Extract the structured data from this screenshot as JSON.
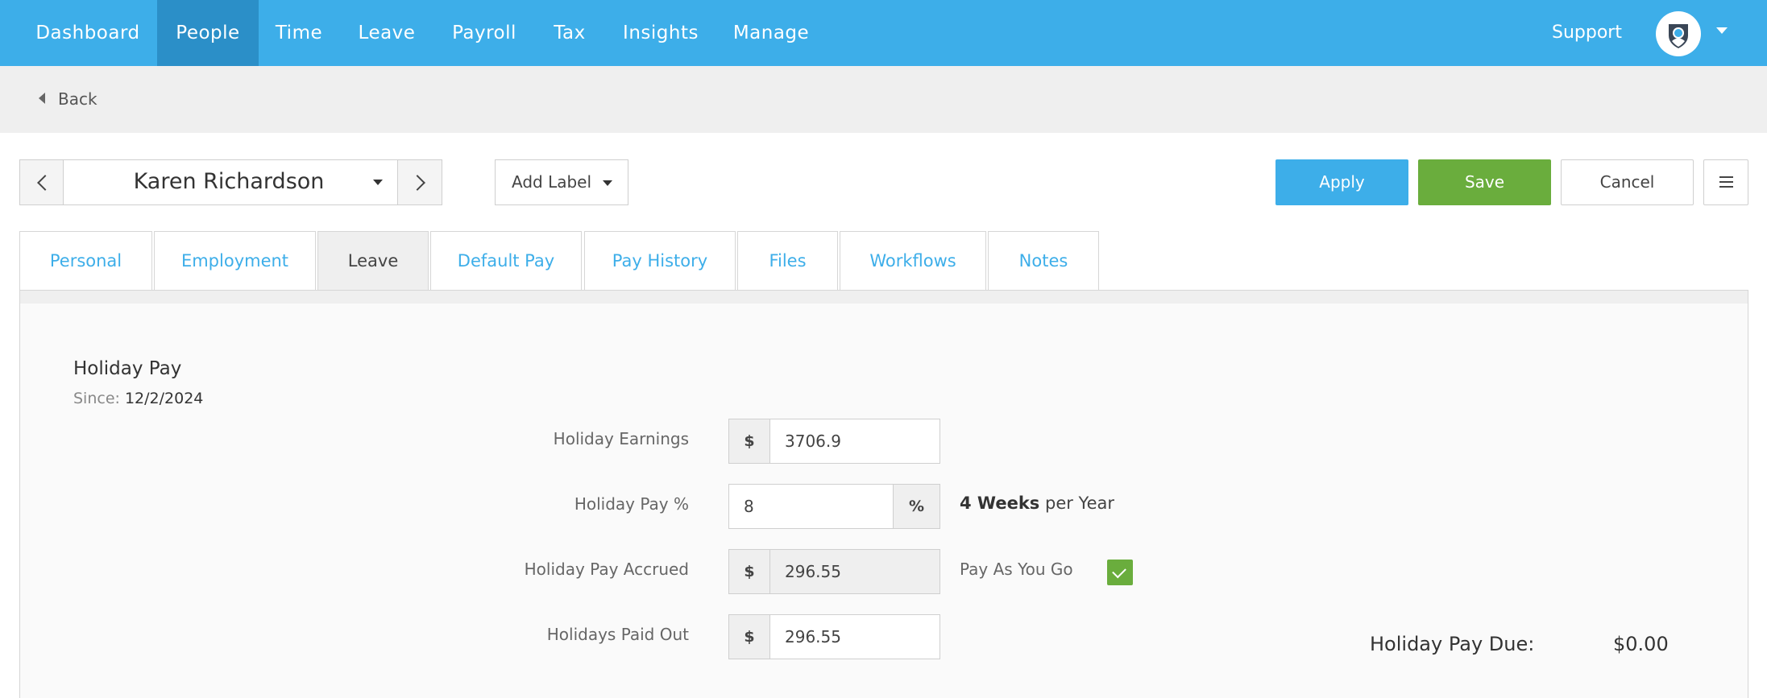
{
  "nav": {
    "items": [
      {
        "label": "Dashboard",
        "active": false
      },
      {
        "label": "People",
        "active": true
      },
      {
        "label": "Time",
        "active": false
      },
      {
        "label": "Leave",
        "active": false
      },
      {
        "label": "Payroll",
        "active": false
      },
      {
        "label": "Tax",
        "active": false
      },
      {
        "label": "Insights",
        "active": false
      },
      {
        "label": "Manage",
        "active": false
      }
    ],
    "support_label": "Support",
    "avatar_icon": "shield-user-icon"
  },
  "backbar": {
    "back_label": "Back"
  },
  "toolbar": {
    "employee_name": "Karen Richardson",
    "add_label": "Add Label",
    "apply_label": "Apply",
    "save_label": "Save",
    "cancel_label": "Cancel"
  },
  "tabs": [
    {
      "label": "Personal",
      "active": false
    },
    {
      "label": "Employment",
      "active": false
    },
    {
      "label": "Leave",
      "active": true
    },
    {
      "label": "Default Pay",
      "active": false
    },
    {
      "label": "Pay History",
      "active": false
    },
    {
      "label": "Files",
      "active": false
    },
    {
      "label": "Workflows",
      "active": false
    },
    {
      "label": "Notes",
      "active": false
    }
  ],
  "holiday": {
    "title": "Holiday Pay",
    "since_label": "Since:",
    "since_value": "12/2/2024",
    "earnings_label": "Holiday Earnings",
    "earnings_prefix": "$",
    "earnings_value": "3706.9",
    "pct_label": "Holiday Pay %",
    "pct_value": "8",
    "pct_suffix": "%",
    "weeks_bold": "4 Weeks",
    "weeks_rest": "per Year",
    "accrued_label": "Holiday Pay Accrued",
    "accrued_prefix": "$",
    "accrued_value": "296.55",
    "payg_label": "Pay As You Go",
    "payg_checked": true,
    "paid_out_label": "Holidays Paid Out",
    "paid_out_prefix": "$",
    "paid_out_value": "296.55",
    "due_label": "Holiday Pay Due:",
    "due_value": "$0.00"
  },
  "colors": {
    "primary": "#3daee9",
    "active_nav": "#2b8fc8",
    "save": "#6aad3d"
  }
}
